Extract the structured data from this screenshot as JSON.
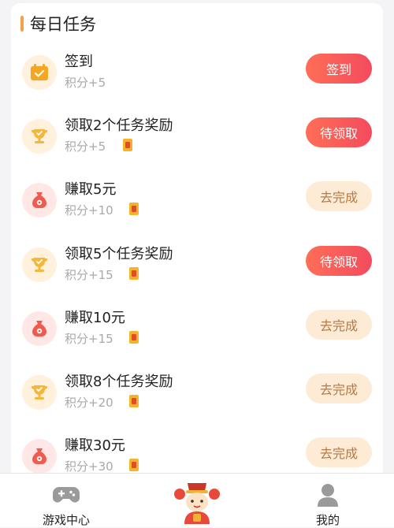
{
  "section_title": "每日任务",
  "tasks": [
    {
      "name": "签到",
      "points": "积分+5",
      "button": "签到",
      "button_style": "primary",
      "icon": "calendar-check-icon",
      "coupon": false
    },
    {
      "name": "领取2个任务奖励",
      "points": "积分+5",
      "button": "待领取",
      "button_style": "primary",
      "icon": "trophy-icon",
      "coupon": true
    },
    {
      "name": "赚取5元",
      "points": "积分+10",
      "button": "去完成",
      "button_style": "secondary",
      "icon": "money-bag-icon",
      "coupon": true
    },
    {
      "name": "领取5个任务奖励",
      "points": "积分+15",
      "button": "待领取",
      "button_style": "primary",
      "icon": "trophy-icon",
      "coupon": true
    },
    {
      "name": "赚取10元",
      "points": "积分+15",
      "button": "去完成",
      "button_style": "secondary",
      "icon": "money-bag-icon",
      "coupon": true
    },
    {
      "name": "领取8个任务奖励",
      "points": "积分+20",
      "button": "去完成",
      "button_style": "secondary",
      "icon": "trophy-icon",
      "coupon": true
    },
    {
      "name": "赚取30元",
      "points": "积分+30",
      "button": "去完成",
      "button_style": "secondary",
      "icon": "money-bag-icon",
      "coupon": true
    }
  ],
  "tabbar": {
    "left_label": "游戏中心",
    "right_label": "我的"
  },
  "colors": {
    "accent": "#f5a04a",
    "primary_button": "#f55a5a",
    "secondary_button": "#fdebd5",
    "secondary_text": "#b57a45"
  }
}
